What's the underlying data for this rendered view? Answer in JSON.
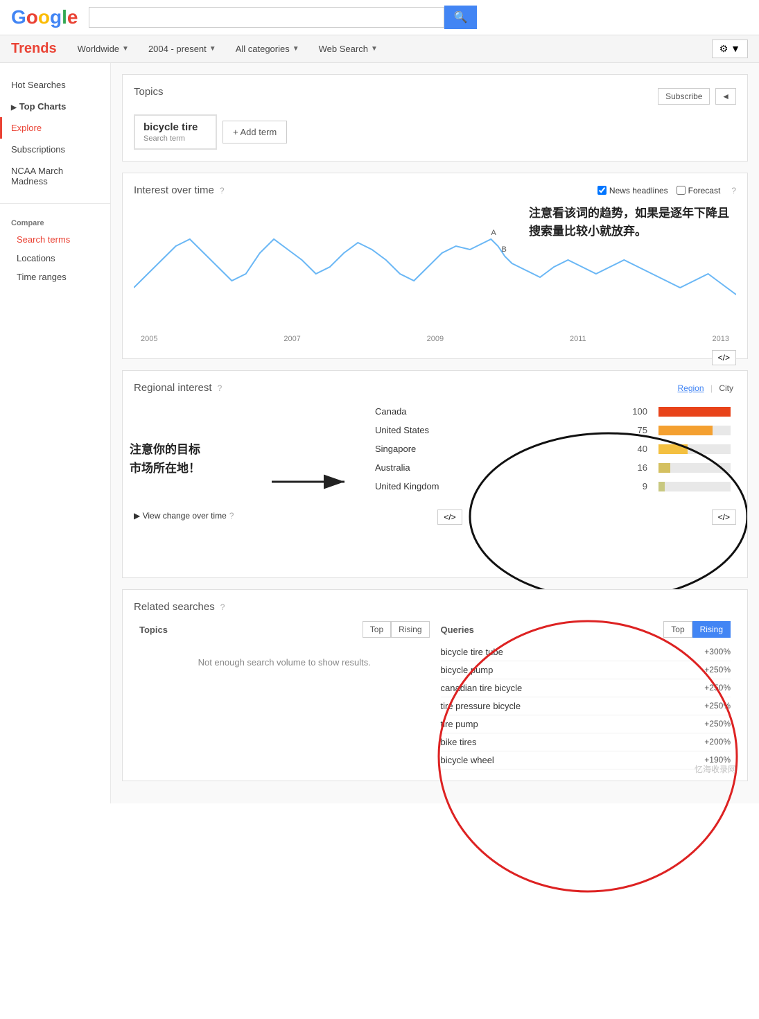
{
  "header": {
    "logo": "Google",
    "search_placeholder": "",
    "search_btn": "🔍"
  },
  "navbar": {
    "trends_label": "Trends",
    "filters": [
      {
        "label": "Worldwide",
        "id": "worldwide"
      },
      {
        "label": "2004 - present",
        "id": "timerange"
      },
      {
        "label": "All categories",
        "id": "categories"
      },
      {
        "label": "Web Search",
        "id": "searchtype"
      }
    ],
    "gear_btn": "⚙"
  },
  "sidebar": {
    "items": [
      {
        "label": "Hot Searches",
        "id": "hot-searches",
        "active": false
      },
      {
        "label": "Top Charts",
        "id": "top-charts",
        "active": false,
        "arrow": true
      },
      {
        "label": "Explore",
        "id": "explore",
        "active": true
      },
      {
        "label": "Subscriptions",
        "id": "subscriptions",
        "active": false
      },
      {
        "label": "NCAA March Madness",
        "id": "ncaa",
        "active": false
      }
    ],
    "compare_label": "Compare",
    "compare_items": [
      {
        "label": "Search terms",
        "id": "search-terms",
        "active": true
      },
      {
        "label": "Locations",
        "id": "locations",
        "active": false
      },
      {
        "label": "Time ranges",
        "id": "time-ranges",
        "active": false
      }
    ]
  },
  "topics": {
    "title": "Topics",
    "subscribe_label": "Subscribe",
    "share_label": "◄",
    "term": {
      "name": "bicycle tire",
      "type": "Search term"
    },
    "add_term_label": "+ Add term"
  },
  "interest_over_time": {
    "title": "Interest over time",
    "news_headlines_label": "News headlines",
    "forecast_label": "Forecast",
    "x_labels": [
      "2005",
      "2007",
      "2009",
      "2011",
      "2013"
    ],
    "annotation_chinese": "注意看该词的趋势，如果是逐年下降且\n搜索量比较小就放弃。",
    "embed_label": "</>",
    "news_checked": true,
    "forecast_checked": false
  },
  "regional_interest": {
    "title": "Regional interest",
    "tabs": [
      {
        "label": "Region",
        "active": true
      },
      {
        "label": "City",
        "active": false
      }
    ],
    "rows": [
      {
        "region": "Canada",
        "value": 100,
        "bar_pct": 100,
        "color": "#E8431A"
      },
      {
        "region": "United States",
        "value": 75,
        "bar_pct": 75,
        "color": "#F4A030"
      },
      {
        "region": "Singapore",
        "value": 40,
        "bar_pct": 40,
        "color": "#F4C040"
      },
      {
        "region": "Australia",
        "value": 16,
        "bar_pct": 16,
        "color": "#D4C060"
      },
      {
        "region": "United Kingdom",
        "value": 9,
        "bar_pct": 9,
        "color": "#C8C880"
      }
    ],
    "annotation_chinese": "注意你的目标\n市场所在地！",
    "view_change_label": "▶ View change over time",
    "embed_label": "</>"
  },
  "related_searches": {
    "title": "Related searches",
    "topics_label": "Topics",
    "queries_label": "Queries",
    "top_label": "Top",
    "rising_label": "Rising",
    "topics_no_results": "Not enough search volume to show results.",
    "queries": [
      {
        "term": "bicycle tire tube",
        "pct": "+300%"
      },
      {
        "term": "bicycle pump",
        "pct": "+250%"
      },
      {
        "term": "canadian tire bicycle",
        "pct": "+250%"
      },
      {
        "term": "tire pressure bicycle",
        "pct": "+250%"
      },
      {
        "term": "tire pump",
        "pct": "+250%"
      },
      {
        "term": "bike tires",
        "pct": "+200%"
      },
      {
        "term": "bicycle wheel",
        "pct": "+190%"
      }
    ]
  },
  "watermark": "忆海收录网"
}
